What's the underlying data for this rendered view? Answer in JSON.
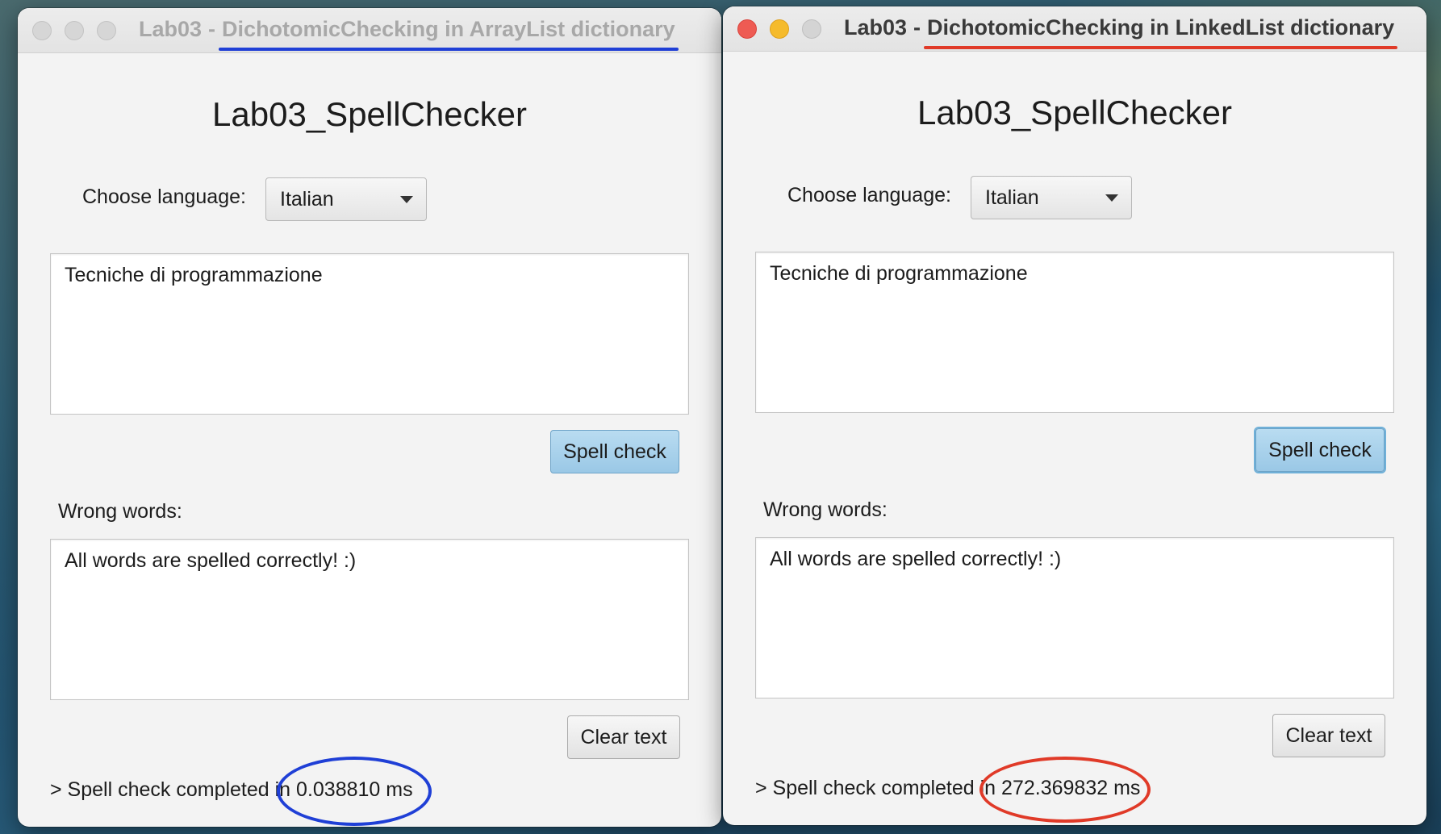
{
  "windows": [
    {
      "title_prefix": "Lab03",
      "title_sep": "-",
      "title_main": "DichotomicChecking in ArrayList dictionary",
      "app_title": "Lab03_SpellChecker",
      "language_label": "Choose language:",
      "language_selected": "Italian",
      "input_text": "Tecniche di programmazione",
      "spell_check_label": "Spell check",
      "wrong_words_label": "Wrong words:",
      "wrong_words_text": "All words are spelled correctly! :)",
      "clear_label": "Clear text",
      "status_prefix": "> Spell check completed in",
      "status_time": "0.038810 ms",
      "annotation_color": "#1f3fd6"
    },
    {
      "title_prefix": "Lab03",
      "title_sep": "-",
      "title_main": "DichotomicChecking in LinkedList dictionary",
      "app_title": "Lab03_SpellChecker",
      "language_label": "Choose language:",
      "language_selected": "Italian",
      "input_text": "Tecniche di programmazione",
      "spell_check_label": "Spell check",
      "wrong_words_label": "Wrong words:",
      "wrong_words_text": "All words are spelled correctly! :)",
      "clear_label": "Clear text",
      "status_prefix": "> Spell check completed in",
      "status_time": "272.369832 ms",
      "annotation_color": "#e03a28"
    }
  ]
}
